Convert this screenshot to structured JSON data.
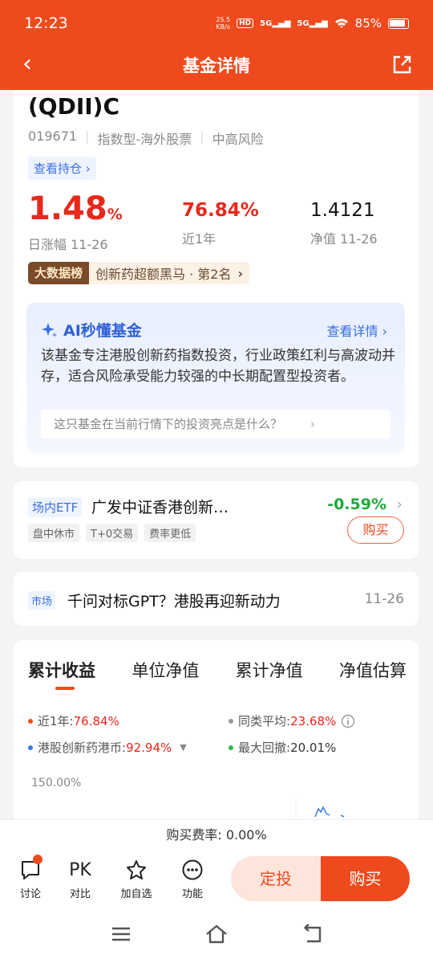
{
  "status_bar": {
    "time": "12:23",
    "net_speed_value": "25.5",
    "net_speed_unit": "KB/s",
    "hd": "HD",
    "signal1": "5G",
    "signal2": "5G",
    "battery": "85%"
  },
  "header": {
    "title": "基金详情"
  },
  "fund": {
    "name": "(QDII)C",
    "code": "019671",
    "category": "指数型-海外股票",
    "risk": "中高风险",
    "holdings_link": "查看持仓 ›",
    "day_change": "1.48",
    "day_change_unit": "%",
    "day_change_label": "日涨幅 11-26",
    "year_return": "76.84%",
    "year_return_label": "近1年",
    "nav": "1.4121",
    "nav_label": "净值 11-26",
    "rank_tag": "大数据榜",
    "rank_text": "创新药超额黑马 · 第2名"
  },
  "ai": {
    "title": "AI秒懂基金",
    "more": "查看详情 ›",
    "desc": "该基金专注港股创新药指数投资，行业政策红利与高波动并存，适合风险承受能力较强的中长期配置型投资者。",
    "question": "这只基金在当前行情下的投资亮点是什么？"
  },
  "etf": {
    "tag": "场内ETF",
    "name": "广发中证香港创新…",
    "change": "-0.59%",
    "chips": [
      "盘中休市",
      "T+0交易",
      "费率更低"
    ],
    "buy": "购买"
  },
  "news": {
    "tag": "市场",
    "title": "千问对标GPT？港股再迎新动力",
    "date": "11-26"
  },
  "perf": {
    "tabs": [
      "累计收益",
      "单位净值",
      "累计净值",
      "净值估算"
    ],
    "legend": [
      {
        "k": "近1年:",
        "v": "76.84%",
        "color": "#ee4a1e"
      },
      {
        "k": "同类平均:",
        "v": "23.68%",
        "color": "#999999"
      },
      {
        "k": "港股创新药港币:",
        "v": "92.94%",
        "color": "#3a7ce0"
      },
      {
        "k": "最大回撤:",
        "v": "20.01%",
        "color": "#38b24a"
      }
    ],
    "y_top": "150.00%"
  },
  "fee": {
    "text": "购买费率: 0.00%"
  },
  "actions": {
    "discuss": "讨论",
    "pk_glyph": "PK",
    "compare": "对比",
    "watch": "加自选",
    "more": "功能",
    "plan": "定投",
    "buy": "购买"
  }
}
